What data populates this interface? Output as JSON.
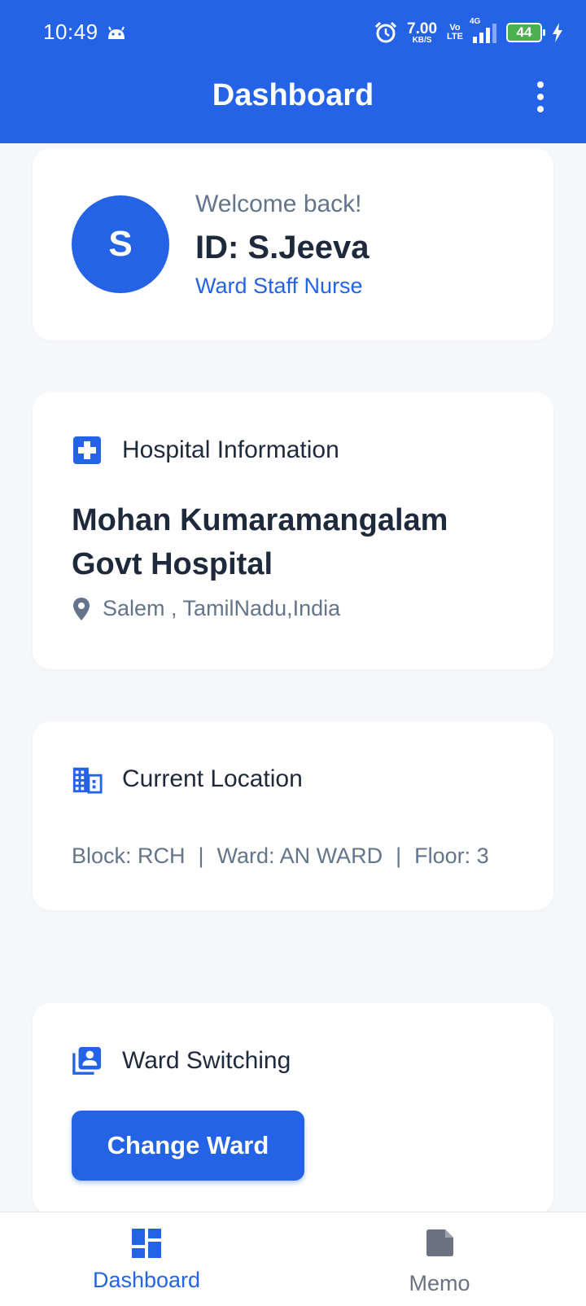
{
  "status_bar": {
    "time": "10:49",
    "net_speed_value": "7.00",
    "net_speed_unit": "KB/S",
    "volte_top": "Vo",
    "volte_bottom": "LTE",
    "network": "4G",
    "battery": "44"
  },
  "app_bar": {
    "title": "Dashboard"
  },
  "profile": {
    "avatar_letter": "S",
    "welcome": "Welcome back!",
    "id": "ID: S.Jeeva",
    "role": "Ward Staff Nurse"
  },
  "hospital": {
    "section_title": "Hospital Information",
    "name": "Mohan Kumaramangalam Govt Hospital",
    "address": "Salem , TamilNadu,India"
  },
  "location": {
    "section_title": "Current Location",
    "block": "Block: RCH",
    "ward": "Ward: AN WARD",
    "floor": "Floor: 3",
    "separator": "|"
  },
  "ward_switching": {
    "section_title": "Ward Switching",
    "button_label": "Change Ward"
  },
  "bottom_nav": {
    "items": [
      {
        "label": "Dashboard",
        "icon": "dashboard-icon",
        "active": true
      },
      {
        "label": "Memo",
        "icon": "memo-icon",
        "active": false
      }
    ]
  },
  "colors": {
    "primary": "#2563e6",
    "background": "#f5f7fa",
    "text_dark": "#1e293b",
    "text_muted": "#64748b",
    "battery": "#4caf50"
  }
}
